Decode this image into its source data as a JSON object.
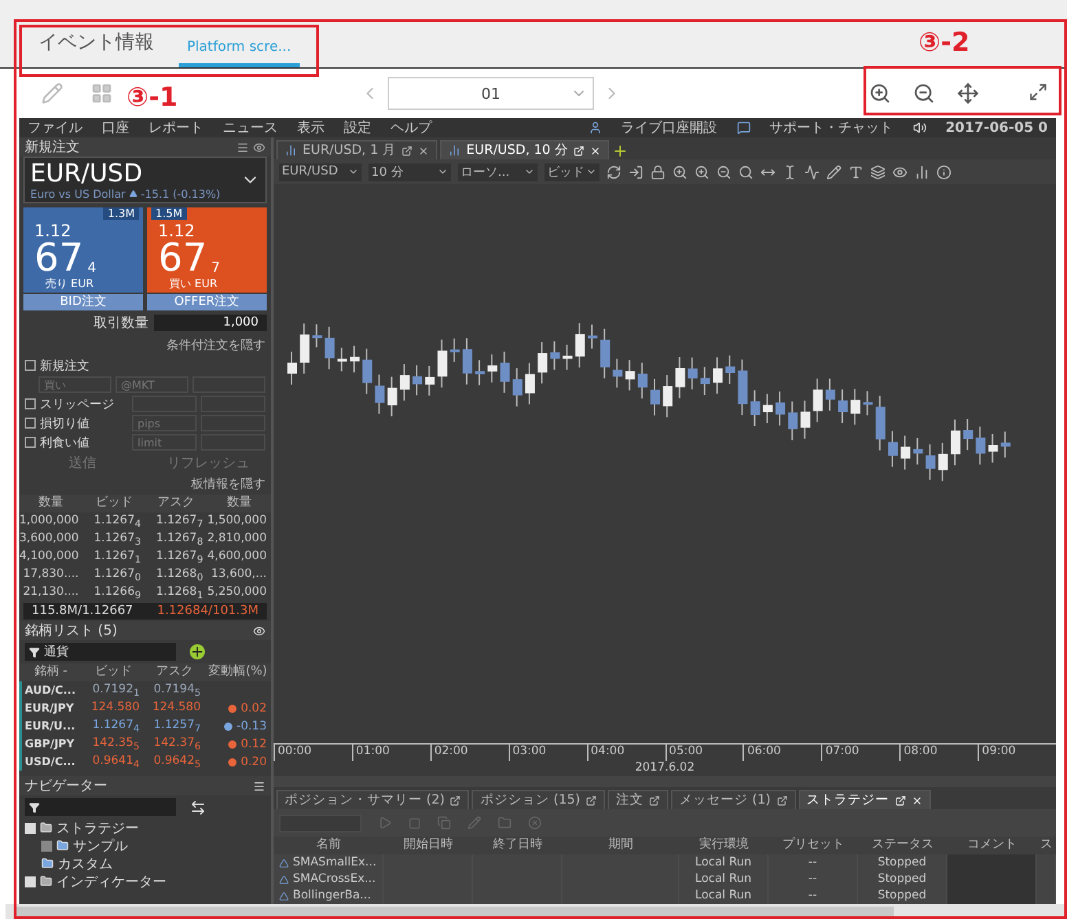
{
  "viewer": {
    "tabs": [
      {
        "label": "イベント情報",
        "selected": false
      },
      {
        "label": "Platform scre...",
        "selected": true
      }
    ],
    "page": "01",
    "annotations": [
      {
        "label": "③-1"
      },
      {
        "label": "③-2"
      }
    ]
  },
  "platform": {
    "menu": [
      "ファイル",
      "口座",
      "レポート",
      "ニュース",
      "表示",
      "設定",
      "ヘルプ"
    ],
    "menu_right": [
      "ライブ口座開設",
      "サポート・チャット"
    ],
    "datetime": "2017-06-05 0",
    "order": {
      "title": "新規注文",
      "symbol": "EUR/USD",
      "description": "Euro vs US Dollar",
      "change": "-15.1 (-0.13%)",
      "bid": {
        "volume": "1.3M",
        "big": "1.12",
        "pips": "67",
        "fraction": "4",
        "label": "売り EUR",
        "button": "BID注文"
      },
      "offer": {
        "volume": "1.5M",
        "big": "1.12",
        "pips": "67",
        "fraction": "7",
        "label": "買い EUR",
        "button": "OFFER注文"
      },
      "quantity_label": "取引数量",
      "quantity": "1,000",
      "conditions_link": "条件付注文を隠す",
      "options": [
        {
          "label": "新規注文",
          "checked": false,
          "fields": [
            "買い",
            "@MKT"
          ]
        },
        {
          "label": "スリッページ",
          "checked": false
        },
        {
          "label": "損切り値",
          "checked": false,
          "fields": [
            "pips"
          ]
        },
        {
          "label": "利食い値",
          "checked": false,
          "fields": [
            "limit"
          ]
        }
      ],
      "buttons": [
        "送信",
        "リフレッシュ"
      ],
      "depth_link": "板情報を隠す"
    },
    "depth": {
      "columns": [
        "数量",
        "ビッド",
        "アスク",
        "数量"
      ],
      "rows": [
        [
          "1,000,000",
          "1.1267$_{4}$",
          "1.1267$_{7}$",
          "1,500,000"
        ],
        [
          "3,600,000",
          "1.1267$_{3}$",
          "1.1267$_{8}$",
          "2,810,000"
        ],
        [
          "4,100,000",
          "1.1267$_{1}$",
          "1.1267$_{9}$",
          "4,600,000"
        ],
        [
          "17,830....",
          "1.1267$_{0}$",
          "1.1268$_{0}$",
          "13,600,..."
        ],
        [
          "21,130....",
          "1.1266$_{9}$",
          "1.1268$_{1}$",
          "5,250,000"
        ]
      ],
      "bid_total": "115.8M/1.12667",
      "ask_total": "1.12684/101.3M"
    },
    "watchlist": {
      "title": "銘柄リスト (5)",
      "filter": "通貨",
      "columns": [
        "銘柄 -",
        "ビッド",
        "アスク",
        "変動幅(%)"
      ],
      "rows": [
        {
          "symbol": "AUD/C...",
          "bid": "0.7192$_{1}$",
          "ask": "0.7194$_{5}$",
          "change": "",
          "color": "#9aa7b8"
        },
        {
          "symbol": "EUR/JPY",
          "bid": "124.580",
          "ask": "124.580",
          "change": "0.02",
          "color": "#e8643a"
        },
        {
          "symbol": "EUR/U...",
          "bid": "1.1267$_{4}$",
          "ask": "1.1257$_{7}$",
          "change": "-0.13",
          "color": "#7aa6e0"
        },
        {
          "symbol": "GBP/JPY",
          "bid": "142.35$_{5}$",
          "ask": "142.37$_{6}$",
          "change": "0.12",
          "color": "#e8643a"
        },
        {
          "symbol": "USD/C...",
          "bid": "0.9641$_{4}$",
          "ask": "0.9642$_{5}$",
          "change": "0.20",
          "color": "#e8643a"
        }
      ]
    },
    "navigator": {
      "title": "ナビゲーター",
      "tree": [
        {
          "label": "ストラテジー",
          "expanded": true,
          "children": [
            {
              "label": "サンプル",
              "expanded": false
            },
            {
              "label": "カスタム"
            }
          ]
        },
        {
          "label": "インディケーター",
          "expanded": true
        }
      ]
    },
    "chart_tabs": [
      {
        "label": "EUR/USD, 1 月",
        "selected": false
      },
      {
        "label": "EUR/USD, 10 分",
        "selected": true
      }
    ],
    "chart_selects": [
      "EUR/USD",
      "10 分",
      "ローソ...",
      "ビッド"
    ],
    "time_axis": [
      "00:00",
      "01:00",
      "02:00",
      "03:00",
      "04:00",
      "05:00",
      "06:00",
      "07:00",
      "08:00",
      "09:00"
    ],
    "date": "2017.6.02",
    "bottom_tabs": [
      {
        "label": "ポジション・サマリー (2)",
        "selected": false
      },
      {
        "label": "ポジション (15)",
        "selected": false
      },
      {
        "label": "注文",
        "selected": false
      },
      {
        "label": "メッセージ (1)",
        "selected": false
      },
      {
        "label": "ストラテジー",
        "selected": true
      }
    ],
    "strategies": {
      "columns": [
        "名前",
        "開始日時",
        "終了日時",
        "期間",
        "実行環境",
        "プリセット",
        "ステータス",
        "コメント",
        "ス"
      ],
      "rows": [
        {
          "name": "SMASmallEx...",
          "run": "Local Run",
          "preset": "--",
          "status": "Stopped"
        },
        {
          "name": "SMACrossEx...",
          "run": "Local Run",
          "preset": "--",
          "status": "Stopped"
        },
        {
          "name": "BollingerBa...",
          "run": "Local Run",
          "preset": "--",
          "status": "Stopped"
        }
      ]
    }
  }
}
